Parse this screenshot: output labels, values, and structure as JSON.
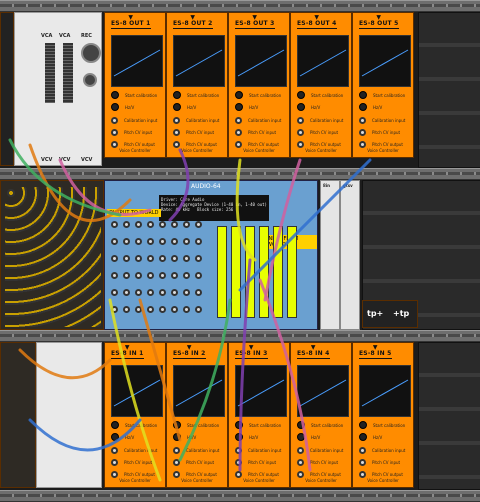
{
  "colors": {
    "orange": "#ff8c00",
    "audio": "#6aa0d0",
    "cable_orange": "#e07a10",
    "cable_pink": "#d060a0",
    "cable_green": "#40b060",
    "cable_blue": "#3070d0",
    "cable_yellow": "#e0e020",
    "cable_purple": "#8040b0"
  },
  "top_strip": {
    "vca_label": "VCA",
    "vca2_label": "VCA",
    "rec_label": "REC",
    "vca_bottom": "VCV",
    "vca2_bottom": "VCV",
    "rec_bottom": "VCV"
  },
  "es8_out": [
    {
      "title": "ES-8 OUT 1"
    },
    {
      "title": "ES-8 OUT 2"
    },
    {
      "title": "ES-8 OUT 3"
    },
    {
      "title": "ES-8 OUT 4"
    },
    {
      "title": "ES-8 OUT 5"
    }
  ],
  "es8_in": [
    {
      "title": "ES-8 IN 1"
    },
    {
      "title": "ES-8 IN 2"
    },
    {
      "title": "ES-8 IN 3"
    },
    {
      "title": "ES-8 IN 4"
    },
    {
      "title": "ES-8 IN 5"
    }
  ],
  "vc": {
    "start": "Start calibration",
    "hzv": "Hz/V",
    "cal_input": "Calibration input",
    "pitch_in": "Pitch CV input",
    "pitch_out": "Pitch CV output",
    "footer": "Voice Controller"
  },
  "audio": {
    "title": "AUDIO-64",
    "driver": "Driver: Core Audio",
    "device": "Device: Aggregate Device (1-40 in, 1-40 out)",
    "rate": "Rate: 48 kHz",
    "block": "Block size: 256",
    "output_label": "OUTPUT TO WORLD",
    "input_label": "INPUT FROM WORLD"
  },
  "right_panel": {
    "label1": "tp+",
    "label2": "+tp",
    "top_label": "8in",
    "top2": "gtsv"
  }
}
